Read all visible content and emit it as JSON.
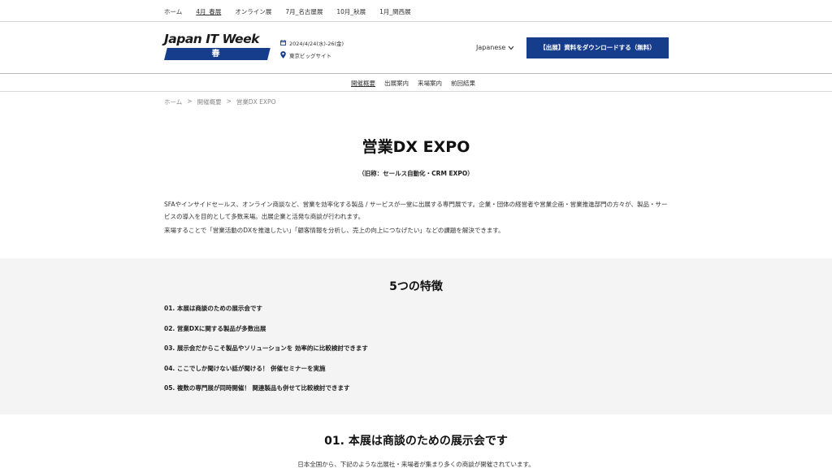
{
  "top_nav": {
    "items": [
      {
        "label": "ホーム"
      },
      {
        "label": "4月_春展",
        "active": true
      },
      {
        "label": "オンライン展"
      },
      {
        "label": "7月_名古屋展"
      },
      {
        "label": "10月_秋展"
      },
      {
        "label": "1月_関西展"
      }
    ]
  },
  "header": {
    "logo": {
      "text": "Japan IT Week",
      "season": "春"
    },
    "event_dates": "2024/4/24(水)-26(金)",
    "venue": "東京ビッグサイト",
    "language": "Japanese",
    "download_button": "【出展】資料をダウンロードする（無料）",
    "brand_color": "#163c8c"
  },
  "sub_nav": {
    "items": [
      {
        "label": "開催概要",
        "active": true
      },
      {
        "label": "出展案内"
      },
      {
        "label": "来場案内"
      },
      {
        "label": "前回結果"
      }
    ]
  },
  "breadcrumb": {
    "items": [
      "ホーム",
      "開催概要",
      "営業DX EXPO"
    ],
    "separator": ">"
  },
  "main": {
    "title": "営業DX EXPO",
    "subtitle": "（旧称：セールス自動化・CRM EXPO）",
    "intro_paragraphs": [
      "SFAやインサイドセールス、オンライン商談など、営業を効率化する製品 / サービスが一堂に出展する専門展です。企業・団体の経営者や営業企画・営業推進部門の方々が、製品・サービスの導入を目的として多数来場。出展企業と活発な商談が行われます。",
      "来場することで「営業活動のDXを推進したい」「顧客情報を分析し、売上の向上につなげたい」などの課題を解決できます。"
    ]
  },
  "features": {
    "title": "5つの特徴",
    "items": [
      "01.  本展は商談のための展示会です",
      "02. 営業DXに関する製品が多数出展",
      "03. 展示会だからこそ製品やソリューションを 効率的に比較検討できます",
      "04. ここでしか聞けない話が聞ける！ 併催セミナーを実施",
      "05. 複数の専門展が同時開催！ 関連製品も併せて比較検討できます"
    ]
  },
  "section2": {
    "title": "01. 本展は商談のための展示会です",
    "text": "日本全国から、下記のような出展社・来場者が集まり多くの商談が開催されています。"
  }
}
